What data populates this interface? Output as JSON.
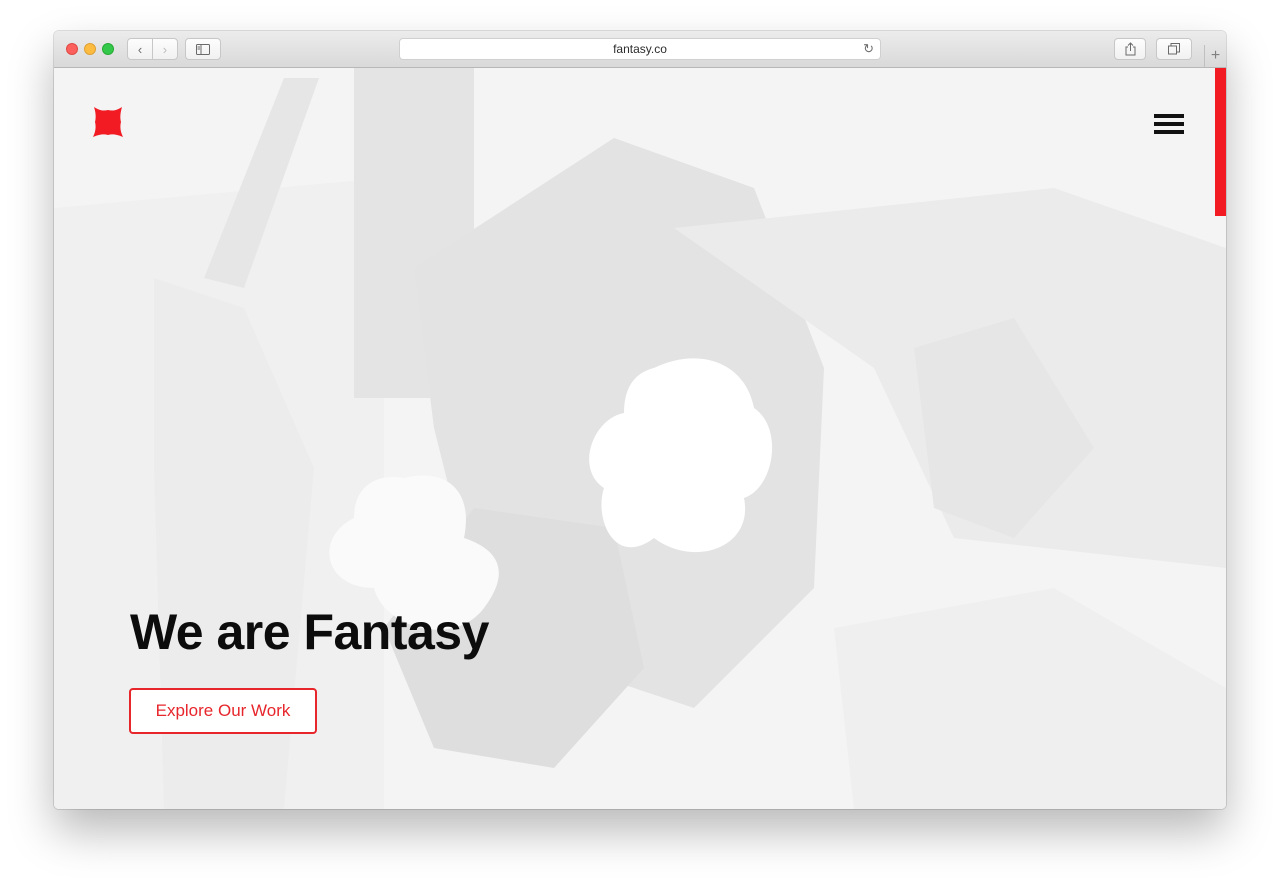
{
  "browser": {
    "url": "fantasy.co",
    "icons": {
      "back": "chevron-left-icon",
      "forward": "chevron-right-icon",
      "sidebar": "sidebar-icon",
      "reload": "reload-icon",
      "share": "share-icon",
      "tabs": "tabs-overview-icon",
      "new_tab": "plus-icon"
    },
    "glyphs": {
      "back": "‹",
      "forward": "›",
      "reload": "↻",
      "new_tab": "+"
    }
  },
  "site": {
    "logo": "fantasy-logo-icon",
    "menu_icon": "hamburger-menu-icon",
    "hero": {
      "title": "We are Fantasy",
      "cta_label": "Explore Our Work"
    },
    "colors": {
      "accent": "#e7262c",
      "text": "#0c0c0c",
      "background": "#f3f3f3"
    }
  }
}
